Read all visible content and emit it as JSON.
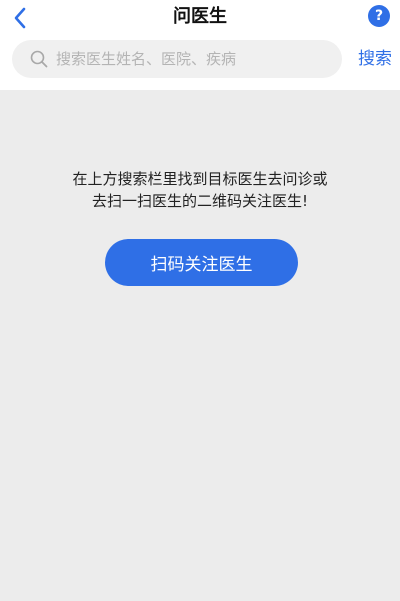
{
  "header": {
    "title": "问医生",
    "back_icon": "chevron-left-icon",
    "help_label": "?"
  },
  "search": {
    "placeholder": "搜索医生姓名、医院、疾病",
    "value": "",
    "button_label": "搜索",
    "icon": "search-icon"
  },
  "empty_state": {
    "line1": "在上方搜索栏里找到目标医生去问诊或",
    "line2": "去扫一扫医生的二维码关注医生!"
  },
  "scan_button": {
    "label": "扫码关注医生"
  },
  "colors": {
    "accent": "#2f6fe6",
    "background": "#ececec",
    "header_bg": "#ffffff",
    "search_bg": "#f0f0f0"
  }
}
